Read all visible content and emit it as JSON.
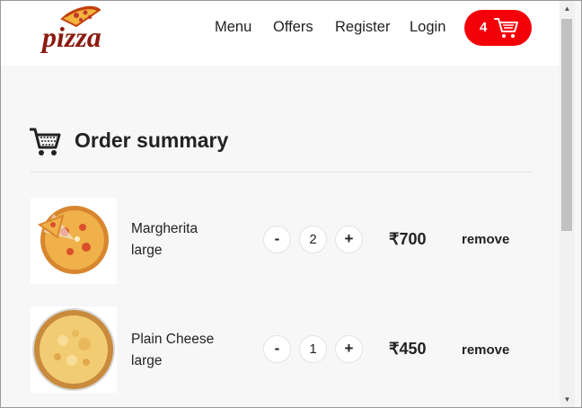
{
  "brand": {
    "logo_text": "pizza"
  },
  "nav": {
    "items": [
      "Menu",
      "Offers",
      "Register",
      "Login"
    ],
    "cart_count": "4"
  },
  "summary": {
    "title": "Order summary"
  },
  "order": [
    {
      "name": "Margherita",
      "size": "large",
      "quantity": "2",
      "price": "₹700",
      "remove_label": "remove",
      "minus": "-",
      "plus": "+"
    },
    {
      "name": "Plain Cheese",
      "size": "large",
      "quantity": "1",
      "price": "₹450",
      "remove_label": "remove",
      "minus": "-",
      "plus": "+"
    }
  ],
  "colors": {
    "accent": "#f40009",
    "brand_text": "#8b1a10",
    "background": "#f7f7f7"
  },
  "icons": {
    "cart": "cart-icon",
    "summary": "cart-icon",
    "logo": "pizza-slice-icon"
  }
}
